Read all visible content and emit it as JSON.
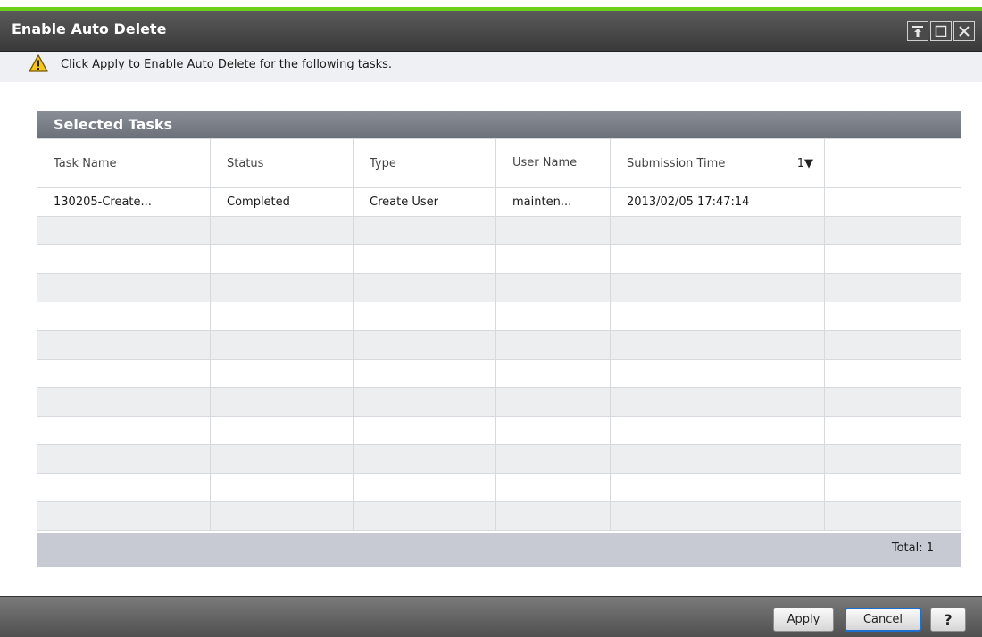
{
  "window": {
    "title": "Enable Auto Delete",
    "controls": [
      "pin-icon",
      "maximize-icon",
      "close-icon"
    ]
  },
  "info": {
    "icon": "warning-icon",
    "text": "Click Apply to Enable Auto Delete for the following tasks."
  },
  "panel": {
    "title": "Selected Tasks",
    "columns": [
      "Task Name",
      "Status",
      "Type",
      "User Name",
      "Submission Time",
      ""
    ],
    "sort_indicator": "1▼",
    "rows": [
      [
        "130205-Create...",
        "Completed",
        "Create User",
        "mainten...",
        "2013/02/05 17:47:14",
        ""
      ]
    ],
    "total_label": "Total:  1"
  },
  "buttons": {
    "apply": "Apply",
    "cancel": "Cancel",
    "help": "?"
  },
  "colors": {
    "accent_line": "#6ecf1a",
    "focus_border": "#1f6fd0"
  }
}
